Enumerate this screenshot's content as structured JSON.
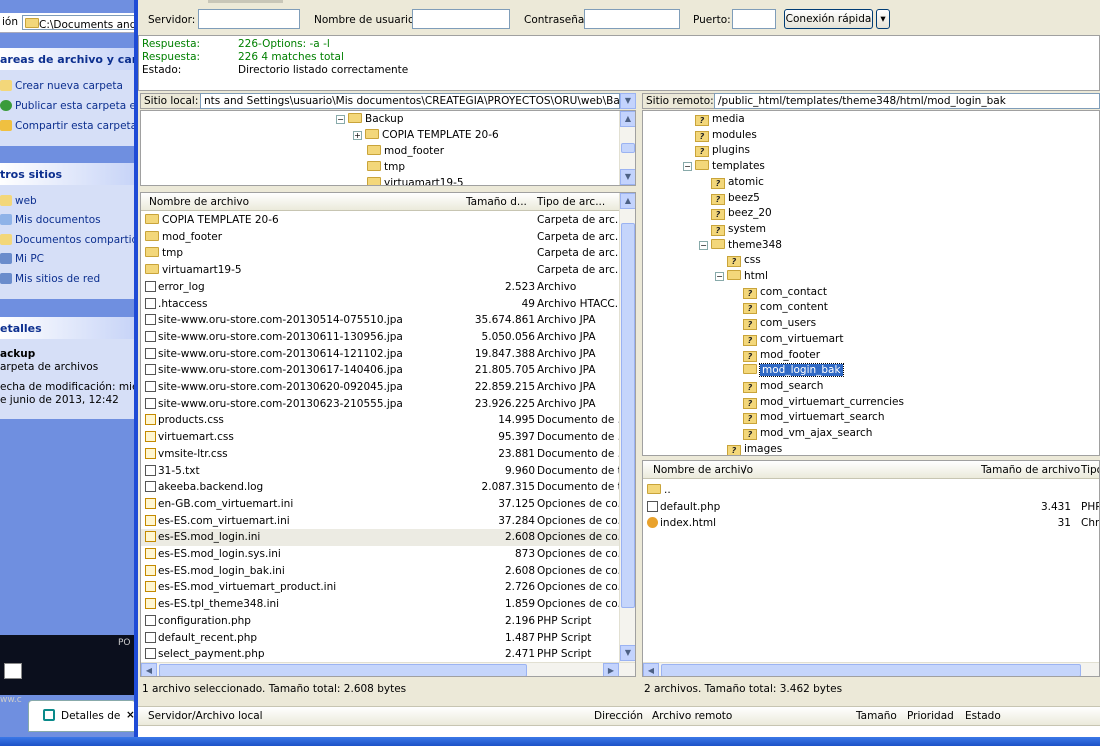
{
  "explorer": {
    "address_label": "ión",
    "address_value": "C:\\Documents and S",
    "tasks_title": "areas de archivo y carpe",
    "tasks": [
      "Crear nueva carpeta",
      "Publicar esta carpeta en W",
      "Compartir esta carpeta"
    ],
    "other_title": "tros sitios",
    "other": [
      "web",
      "Mis documentos",
      "Documentos compartidos",
      "Mi PC",
      "Mis sitios de red"
    ],
    "details_title": "etalles",
    "details_name": "ackup",
    "details_type": "arpeta de archivos",
    "details_mod": "echa de modificación: miércol",
    "details_date": "e junio de 2013, 12:42",
    "thumb_text": "PO",
    "thumb_text2": "ww.c",
    "taskbtn_label": "Detalles de"
  },
  "quickconnect": {
    "server_label": "Servidor:",
    "user_label": "Nombre de usuario:",
    "pass_label": "Contraseña:",
    "port_label": "Puerto:",
    "button": "Conexión rápida",
    "dropdown": "▾"
  },
  "log": [
    {
      "k": "Respuesta:",
      "v": "226-Options: -a -l",
      "c": "green"
    },
    {
      "k": "Respuesta:",
      "v": "226 4 matches total",
      "c": "green"
    },
    {
      "k": "Estado:",
      "v": "Directorio listado correctamente",
      "c": "black"
    }
  ],
  "local": {
    "site_label": "Sitio local:",
    "site_value": "nts and Settings\\usuario\\Mis documentos\\CREATEGIA\\PROYECTOS\\ORU\\web\\Backup\\",
    "tree": [
      "Backup",
      "COPIA TEMPLATE 20-6",
      "mod_footer",
      "tmp",
      "virtuamart19-5"
    ],
    "headers": [
      "Nombre de archivo",
      "Tamaño d...",
      "Tipo de arc..."
    ],
    "files": [
      {
        "n": "COPIA TEMPLATE 20-6",
        "s": "",
        "t": "Carpeta de arc...",
        "i": "folder"
      },
      {
        "n": "mod_footer",
        "s": "",
        "t": "Carpeta de arc...",
        "i": "folder"
      },
      {
        "n": "tmp",
        "s": "",
        "t": "Carpeta de arc...",
        "i": "folder"
      },
      {
        "n": "virtuamart19-5",
        "s": "",
        "t": "Carpeta de arc...",
        "i": "folder"
      },
      {
        "n": "error_log",
        "s": "2.523",
        "t": "Archivo",
        "i": "file"
      },
      {
        "n": ".htaccess",
        "s": "49",
        "t": "Archivo HTACC...",
        "i": "file"
      },
      {
        "n": "site-www.oru-store.com-20130514-075510.jpa",
        "s": "35.674.861",
        "t": "Archivo JPA",
        "i": "file"
      },
      {
        "n": "site-www.oru-store.com-20130611-130956.jpa",
        "s": "5.050.056",
        "t": "Archivo JPA",
        "i": "file"
      },
      {
        "n": "site-www.oru-store.com-20130614-121102.jpa",
        "s": "19.847.388",
        "t": "Archivo JPA",
        "i": "file"
      },
      {
        "n": "site-www.oru-store.com-20130617-140406.jpa",
        "s": "21.805.705",
        "t": "Archivo JPA",
        "i": "file"
      },
      {
        "n": "site-www.oru-store.com-20130620-092045.jpa",
        "s": "22.859.215",
        "t": "Archivo JPA",
        "i": "file"
      },
      {
        "n": "site-www.oru-store.com-20130623-210555.jpa",
        "s": "23.926.225",
        "t": "Archivo JPA",
        "i": "file"
      },
      {
        "n": "products.css",
        "s": "14.995",
        "t": "Documento de ...",
        "i": "edit"
      },
      {
        "n": "virtuemart.css",
        "s": "95.397",
        "t": "Documento de ...",
        "i": "edit"
      },
      {
        "n": "vmsite-ltr.css",
        "s": "23.881",
        "t": "Documento de ...",
        "i": "edit"
      },
      {
        "n": "31-5.txt",
        "s": "9.960",
        "t": "Documento de t...",
        "i": "file"
      },
      {
        "n": "akeeba.backend.log",
        "s": "2.087.315",
        "t": "Documento de t...",
        "i": "file"
      },
      {
        "n": "en-GB.com_virtuemart.ini",
        "s": "37.125",
        "t": "Opciones de co...",
        "i": "edit"
      },
      {
        "n": "es-ES.com_virtuemart.ini",
        "s": "37.284",
        "t": "Opciones de co...",
        "i": "edit"
      },
      {
        "n": "es-ES.mod_login.ini",
        "s": "2.608",
        "t": "Opciones de co...",
        "i": "edit",
        "sel": true
      },
      {
        "n": "es-ES.mod_login.sys.ini",
        "s": "873",
        "t": "Opciones de co...",
        "i": "edit"
      },
      {
        "n": "es-ES.mod_login_bak.ini",
        "s": "2.608",
        "t": "Opciones de co...",
        "i": "edit"
      },
      {
        "n": "es-ES.mod_virtuemart_product.ini",
        "s": "2.726",
        "t": "Opciones de co...",
        "i": "edit"
      },
      {
        "n": "es-ES.tpl_theme348.ini",
        "s": "1.859",
        "t": "Opciones de co...",
        "i": "edit"
      },
      {
        "n": "configuration.php",
        "s": "2.196",
        "t": "PHP Script",
        "i": "file"
      },
      {
        "n": "default_recent.php",
        "s": "1.487",
        "t": "PHP Script",
        "i": "file"
      },
      {
        "n": "select_payment.php",
        "s": "2.471",
        "t": "PHP Script",
        "i": "file"
      }
    ],
    "status": "1 archivo seleccionado. Tamaño total: 2.608 bytes"
  },
  "remote": {
    "site_label": "Sitio remoto:",
    "site_value": "/public_html/templates/theme348/html/mod_login_bak",
    "tree": [
      {
        "n": "media",
        "d": 2,
        "q": true
      },
      {
        "n": "modules",
        "d": 2,
        "q": true
      },
      {
        "n": "plugins",
        "d": 2,
        "q": true
      },
      {
        "n": "templates",
        "d": 2,
        "q": false,
        "e": "−"
      },
      {
        "n": "atomic",
        "d": 3,
        "q": true
      },
      {
        "n": "beez5",
        "d": 3,
        "q": true
      },
      {
        "n": "beez_20",
        "d": 3,
        "q": true
      },
      {
        "n": "system",
        "d": 3,
        "q": true
      },
      {
        "n": "theme348",
        "d": 3,
        "q": false,
        "e": "−"
      },
      {
        "n": "css",
        "d": 4,
        "q": true
      },
      {
        "n": "html",
        "d": 4,
        "q": false,
        "e": "−"
      },
      {
        "n": "com_contact",
        "d": 5,
        "q": true
      },
      {
        "n": "com_content",
        "d": 5,
        "q": true
      },
      {
        "n": "com_users",
        "d": 5,
        "q": true
      },
      {
        "n": "com_virtuemart",
        "d": 5,
        "q": true
      },
      {
        "n": "mod_footer",
        "d": 5,
        "q": true
      },
      {
        "n": "mod_login_bak",
        "d": 5,
        "q": false,
        "sel": true
      },
      {
        "n": "mod_search",
        "d": 5,
        "q": true
      },
      {
        "n": "mod_virtuemart_currencies",
        "d": 5,
        "q": true
      },
      {
        "n": "mod_virtuemart_search",
        "d": 5,
        "q": true
      },
      {
        "n": "mod_vm_ajax_search",
        "d": 5,
        "q": true
      },
      {
        "n": "images",
        "d": 4,
        "q": true
      }
    ],
    "headers": [
      "Nombre de archivo",
      "/",
      "Tamaño de archivo",
      "Tipo"
    ],
    "files": [
      {
        "n": "..",
        "s": "",
        "t": "",
        "i": "folder"
      },
      {
        "n": "default.php",
        "s": "3.431",
        "t": "PHP",
        "i": "file"
      },
      {
        "n": "index.html",
        "s": "31",
        "t": "Chr",
        "i": "chrome"
      }
    ],
    "status": "2 archivos. Tamaño total: 3.462 bytes"
  },
  "queue": {
    "headers": [
      "Servidor/Archivo local",
      "Dirección",
      "Archivo remoto",
      "Tamaño",
      "Prioridad",
      "Estado"
    ]
  }
}
